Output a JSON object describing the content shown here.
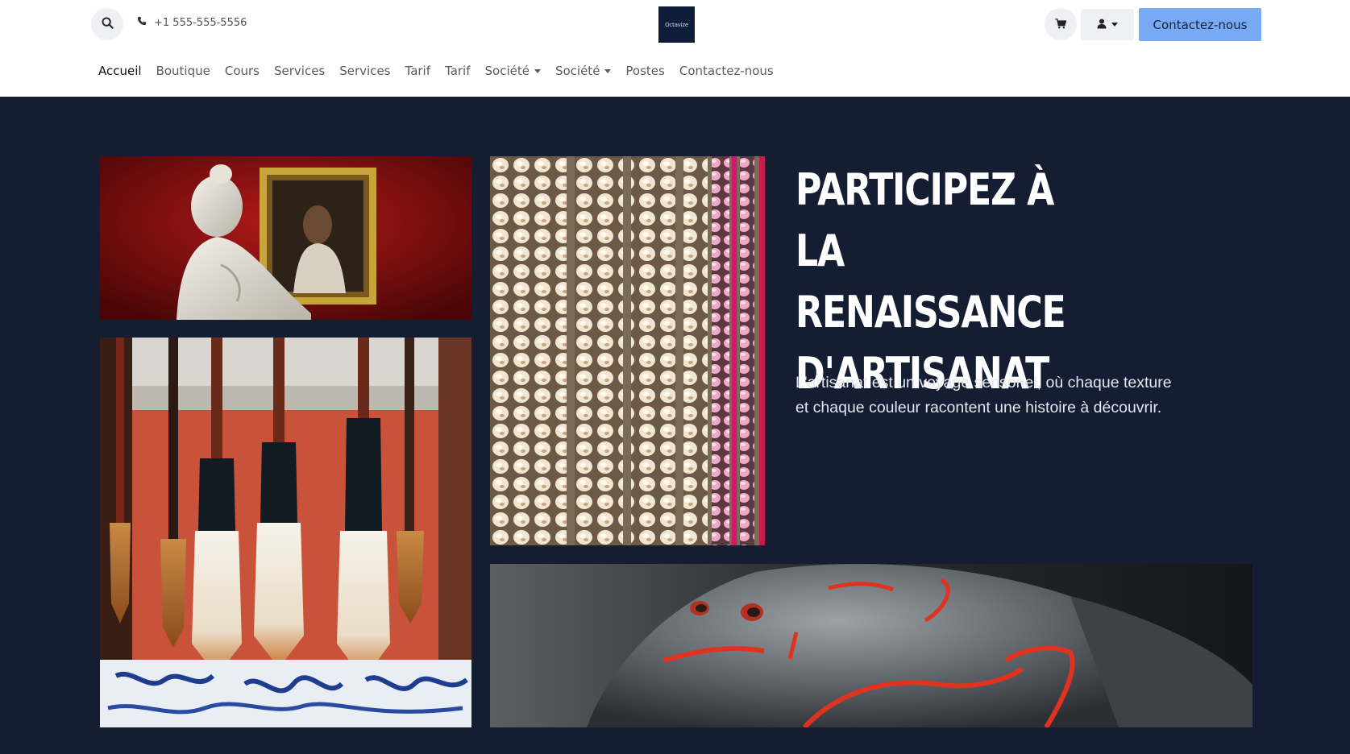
{
  "header": {
    "phone": "+1 555-555-5556",
    "logo_text": "Octavize",
    "contact_button": "Contactez-nous",
    "icons": {
      "search": "search-icon",
      "phone": "phone-icon",
      "cart": "cart-icon",
      "user": "user-icon"
    }
  },
  "nav": {
    "items": [
      {
        "label": "Accueil",
        "active": true
      },
      {
        "label": "Boutique"
      },
      {
        "label": "Cours"
      },
      {
        "label": "Services"
      },
      {
        "label": "Services"
      },
      {
        "label": "Tarif"
      },
      {
        "label": "Tarif"
      },
      {
        "label": "Société",
        "dropdown": true
      },
      {
        "label": "Société",
        "dropdown": true
      },
      {
        "label": "Postes"
      },
      {
        "label": "Contactez-nous"
      }
    ]
  },
  "hero": {
    "title_lines": [
      "PARTICIPEZ À LA",
      "RENAISSANCE",
      "D'ARTISANAT"
    ],
    "text_line1": "L'artisanat est un voyage sensoriel, où chaque texture",
    "text_line2": "et chaque couleur racontent une histoire à découvrir."
  },
  "colors": {
    "hero_background": "#141d32",
    "contact_button": "#78a9f4",
    "logo_background": "#0f1d3b"
  }
}
